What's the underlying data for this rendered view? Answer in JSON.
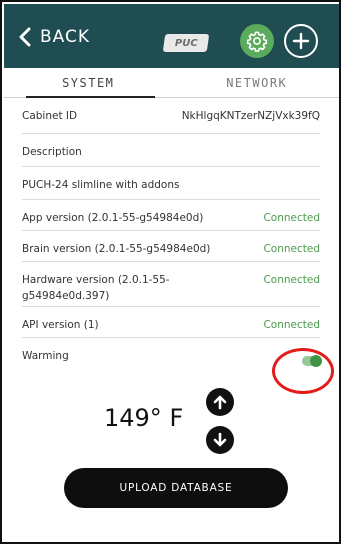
{
  "header": {
    "back_label": "BACK",
    "logo_text": "PUC"
  },
  "tabs": [
    {
      "label": "SYSTEM",
      "active": true
    },
    {
      "label": "NETWORK",
      "active": false
    }
  ],
  "rows": [
    {
      "key": "Cabinet ID",
      "value": "NkHlgqKNTzerNZjVxk39fQ"
    },
    {
      "key": "Description",
      "value": ""
    },
    {
      "key": "PUCH-24 slimline with addons",
      "value": ""
    },
    {
      "key": "App version (2.0.1-55-g54984e0d)",
      "value": "Connected"
    },
    {
      "key": "Brain version (2.0.1-55-g54984e0d)",
      "value": "Connected"
    },
    {
      "key": "Hardware version (2.0.1-55-g54984e0d.397)",
      "value": "Connected"
    },
    {
      "key": "API version (1)",
      "value": "Connected"
    },
    {
      "key": "Warming",
      "value": ""
    }
  ],
  "warming_toggle_on": true,
  "temperature": "149° F",
  "upload_button": "UPLOAD DATABASE",
  "colors": {
    "header_bg": "#1f4d52",
    "accent_green": "#5bab5d",
    "status_green": "#4e9a4f",
    "highlight_red": "#e31b1b"
  }
}
